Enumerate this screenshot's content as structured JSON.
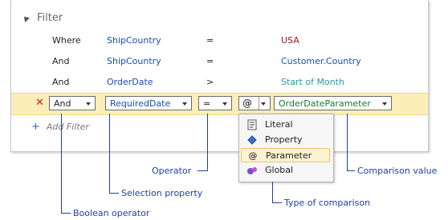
{
  "filter": {
    "title": "Filter",
    "rows": [
      {
        "operator": "Where",
        "field": "ShipCountry",
        "comparison": "=",
        "value": "USA"
      },
      {
        "operator": "And",
        "field": "ShipCountry",
        "comparison": "=",
        "value": "Customer.Country"
      },
      {
        "operator": "And",
        "field": "OrderDate",
        "comparison": ">",
        "value": "Start of Month"
      }
    ],
    "edit_row": {
      "delete_icon": "x-icon",
      "operator": "And",
      "field": "RequiredDate",
      "comparison": "=",
      "value_type": "@",
      "value": "OrderDateParameter"
    },
    "add_filter": "Add Filter"
  },
  "type_menu": {
    "items": [
      {
        "label": "Literal",
        "icon": "literal-icon"
      },
      {
        "label": "Property",
        "icon": "property-icon"
      },
      {
        "label": "Parameter",
        "icon": "parameter-icon"
      },
      {
        "label": "Global",
        "icon": "global-icon"
      }
    ],
    "selected": "Parameter"
  },
  "callouts": {
    "operator": "Operator",
    "comparison_value": "Comparison value",
    "selection_property": "Selection property",
    "type_of_comparison": "Type of comparison",
    "boolean_operator": "Boolean operator"
  },
  "colors": {
    "field_blue": "#1a4fb4",
    "value_red": "#a01818",
    "value_teal": "#2a9aa4",
    "value_green": "#1a7a2a",
    "edit_row_bg": "#fbeeb8",
    "callout_blue": "#1f3fa0"
  }
}
